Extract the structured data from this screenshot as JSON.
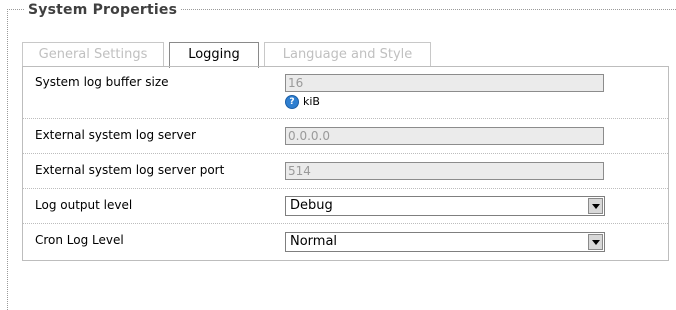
{
  "section": {
    "title": "System Properties"
  },
  "tabs": [
    {
      "label": "General Settings",
      "active": false
    },
    {
      "label": "Logging",
      "active": true
    },
    {
      "label": "Language and Style",
      "active": false
    }
  ],
  "fields": {
    "log_buffer": {
      "label": "System log buffer size",
      "value": "16",
      "unit": "kiB",
      "help_icon": "help-icon"
    },
    "log_server": {
      "label": "External system log server",
      "value": "0.0.0.0"
    },
    "log_port": {
      "label": "External system log server port",
      "value": "514"
    },
    "log_level": {
      "label": "Log output level",
      "selected": "Debug"
    },
    "cron_level": {
      "label": "Cron Log Level",
      "selected": "Normal"
    }
  },
  "colors": {
    "disabled_text": "#c0c0c0",
    "input_bg": "#ebebeb",
    "help_icon": "#2f7fd0"
  }
}
